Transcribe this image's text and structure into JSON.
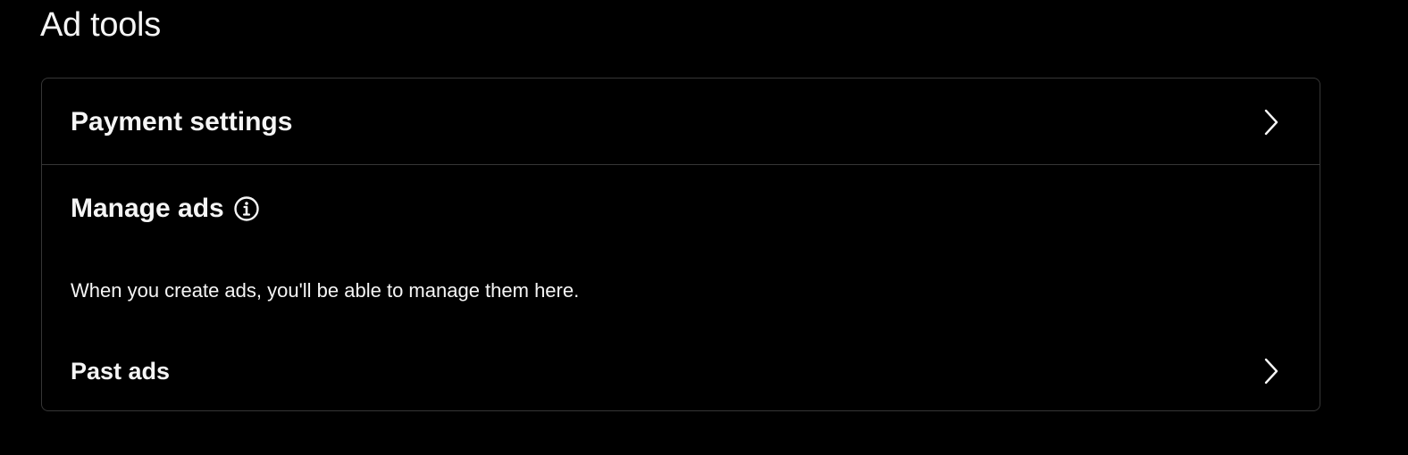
{
  "header": {
    "title": "Ad tools"
  },
  "payment": {
    "label": "Payment settings",
    "chevron_icon": "chevron-right-icon"
  },
  "manage": {
    "label": "Manage ads",
    "info_icon": "info-circle-icon",
    "empty_message": "When you create ads, you'll be able to manage them here."
  },
  "past": {
    "label": "Past ads",
    "chevron_icon": "chevron-right-icon"
  },
  "colors": {
    "background": "#000000",
    "text": "#f5f5f5",
    "border": "#363636"
  }
}
